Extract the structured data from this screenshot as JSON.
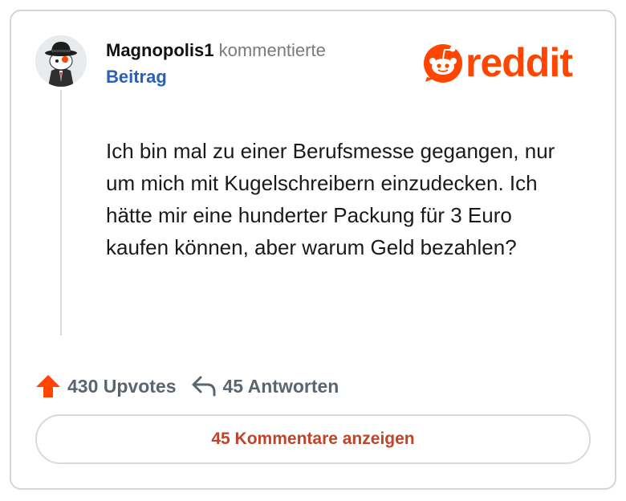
{
  "post": {
    "author": "Magnopolis1",
    "action": "kommentierte",
    "post_link": "Beitrag",
    "body": "Ich bin mal zu einer Berufsmesse gegangen, nur um mich mit Kugelschreibern einzudecken. Ich hätte mir eine hunderter Packung für 3 Euro kaufen können, aber warum Geld bezahlen?"
  },
  "brand": {
    "wordmark": "reddit",
    "color": "#ff4500"
  },
  "stats": {
    "upvotes": "430 Upvotes",
    "replies": "45 Antworten",
    "upvote_icon": "upvote-arrow-icon",
    "reply_icon": "reply-arrow-icon",
    "upvote_color": "#ff4500"
  },
  "comments_button": {
    "label": "45 Kommentare anzeigen",
    "color": "#c0432a"
  }
}
